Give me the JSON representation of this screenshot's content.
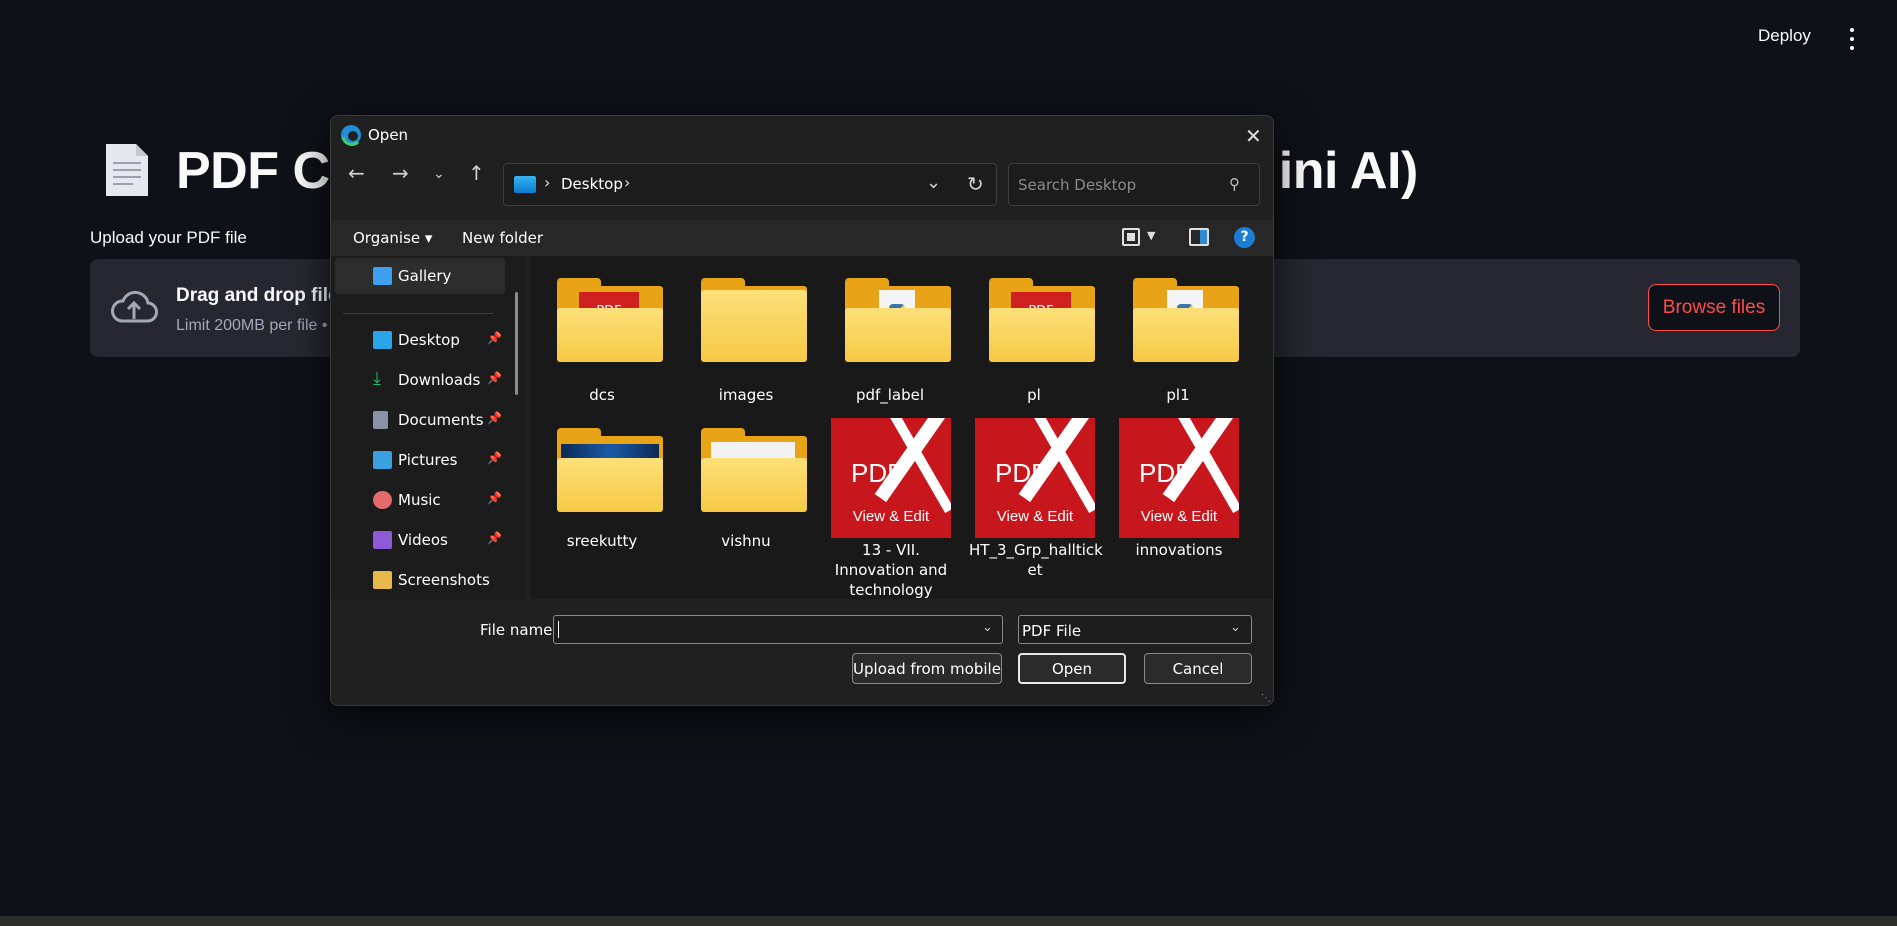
{
  "page": {
    "deploy_label": "Deploy",
    "title": "PDF Co",
    "title_tail": "ini AI)",
    "upload_label": "Upload your PDF file",
    "dropzone_title": "Drag and drop file",
    "dropzone_sub": "Limit 200MB per file •",
    "browse_label": "Browse files"
  },
  "dialog": {
    "title": "Open",
    "close_glyph": "✕",
    "address": {
      "location": "Desktop",
      "sep": "›"
    },
    "search_placeholder": "Search Desktop",
    "toolbar": {
      "organise": "Organise ▾",
      "new_folder": "New folder",
      "help": "?"
    },
    "nav": [
      {
        "label": "Gallery",
        "pinned": false,
        "color": "#3fa0f0"
      },
      {
        "label": "Desktop",
        "pinned": true,
        "color": "#2aa4e8"
      },
      {
        "label": "Downloads",
        "pinned": true,
        "color": "#2bb673"
      },
      {
        "label": "Documents",
        "pinned": true,
        "color": "#8a94a6"
      },
      {
        "label": "Pictures",
        "pinned": true,
        "color": "#3aa0e0"
      },
      {
        "label": "Music",
        "pinned": true,
        "color": "#e36b6b"
      },
      {
        "label": "Videos",
        "pinned": true,
        "color": "#8e5ad8"
      },
      {
        "label": "Screenshots",
        "pinned": false,
        "color": "#e8b94a"
      }
    ],
    "files": [
      {
        "name": "dcs",
        "kind": "folder-pdf"
      },
      {
        "name": "images",
        "kind": "folder"
      },
      {
        "name": "pdf_label",
        "kind": "folder-py"
      },
      {
        "name": "pl",
        "kind": "folder-pdf"
      },
      {
        "name": "pl1",
        "kind": "folder-py"
      },
      {
        "name": "sreekutty",
        "kind": "folder-photo"
      },
      {
        "name": "vishnu",
        "kind": "folder-doc"
      },
      {
        "name": "13 - VII. Innovation and technology",
        "kind": "pdf"
      },
      {
        "name": "HT_3_Grp_halltick et",
        "kind": "pdf"
      },
      {
        "name": "innovations",
        "kind": "pdf"
      }
    ],
    "pdf_thumb": {
      "brand": "PDF",
      "caption": "View & Edit"
    },
    "footer": {
      "file_name_label": "File name:",
      "file_name_value": "",
      "file_type": "PDF File",
      "upload_mobile": "Upload from mobile",
      "open": "Open",
      "cancel": "Cancel"
    }
  }
}
